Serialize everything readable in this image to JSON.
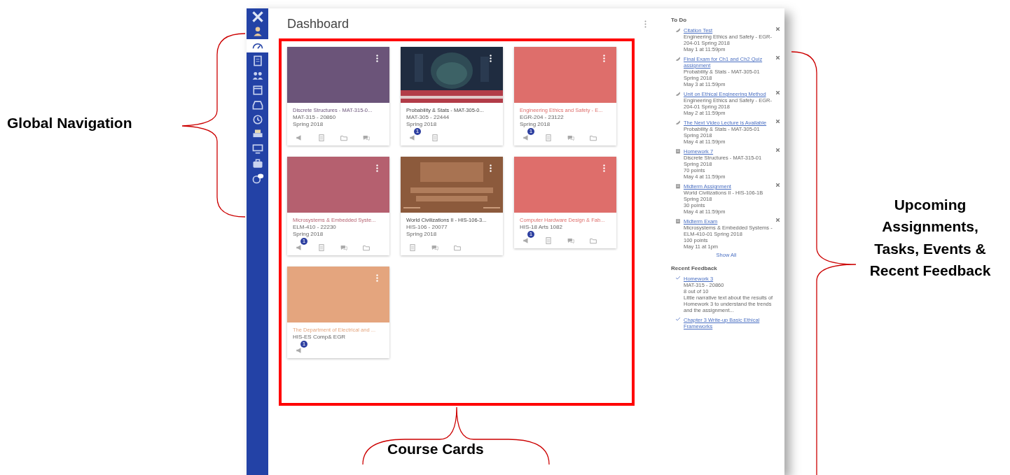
{
  "annotations": [
    {
      "kind": "left",
      "label": "Global Navigation"
    },
    {
      "kind": "bottom",
      "label": "Course Cards"
    },
    {
      "kind": "right",
      "label": "Upcoming Assignments, Tasks, Events & Recent Feedback"
    }
  ],
  "nav": [
    {
      "kind": "logo",
      "selected": false
    },
    {
      "kind": "account",
      "selected": false
    },
    {
      "kind": "dashboard",
      "selected": true
    },
    {
      "kind": "courses",
      "selected": false
    },
    {
      "kind": "groups",
      "selected": false
    },
    {
      "kind": "calendar",
      "selected": false
    },
    {
      "kind": "inbox",
      "selected": false
    },
    {
      "kind": "history",
      "selected": false
    },
    {
      "kind": "print",
      "selected": false
    },
    {
      "kind": "studio",
      "selected": false
    },
    {
      "kind": "commons",
      "selected": false
    },
    {
      "kind": "help",
      "selected": false
    }
  ],
  "page_title": "Dashboard",
  "cards": [
    {
      "kind": "color",
      "color": "#6b5479",
      "title": "Discrete Structures - MAT-315-0...",
      "code": "MAT-315 - 20860",
      "term": "Spring 2018",
      "actions": [
        {
          "kind": "announcements"
        },
        {
          "kind": "assignments"
        },
        {
          "kind": "files"
        },
        {
          "kind": "discussions"
        }
      ]
    },
    {
      "kind": "picture",
      "title": "Probability & Stats - MAT-305-0...",
      "code": "MAT-305 - 22444",
      "term": "Spring 2018",
      "actions": [
        {
          "kind": "announcements",
          "badge": "1"
        },
        {
          "kind": "assignments"
        }
      ]
    },
    {
      "kind": "color",
      "color": "#de6e6b",
      "title": "Engineering Ethics and Safety - E...",
      "code": "EGR-204 - 23122",
      "term": "Spring 2018",
      "actions": [
        {
          "kind": "announcements",
          "badge": "1"
        },
        {
          "kind": "assignments"
        },
        {
          "kind": "discussions"
        },
        {
          "kind": "files"
        }
      ]
    },
    {
      "kind": "color",
      "color": "#b5606f",
      "title": "Microsystems & Embedded Syste...",
      "code": "ELM-410 - 22230",
      "term": "Spring 2018",
      "actions": [
        {
          "kind": "announcements",
          "badge": "1"
        },
        {
          "kind": "assignments"
        },
        {
          "kind": "discussions"
        },
        {
          "kind": "files"
        }
      ]
    },
    {
      "kind": "picture",
      "title": "World Civilizations II - HIS-106-3...",
      "code": "HIS-106 - 20077",
      "term": "Spring 2018",
      "actions": [
        {
          "kind": "assignments"
        },
        {
          "kind": "discussions"
        },
        {
          "kind": "files"
        }
      ]
    },
    {
      "kind": "color",
      "color": "#de6e6b",
      "title": "Computer Hardware Design & Fab...",
      "code": "HIS-18 Arts 1082",
      "actions": [
        {
          "kind": "announcements",
          "badge": "1"
        },
        {
          "kind": "assignments"
        },
        {
          "kind": "discussions"
        },
        {
          "kind": "files"
        }
      ]
    },
    {
      "kind": "color",
      "color": "#e4a57e",
      "title": "The Department of Electrical and ...",
      "code": "HIS-ES Comp& EGR",
      "actions": [
        {
          "kind": "announcements",
          "badge": "1"
        }
      ]
    }
  ],
  "todo": {
    "title": "To Do",
    "items": [
      {
        "kind": "quiz",
        "title": "Citation Test",
        "course": "Engineering Ethics and Safety - EGR-204-01 Spring 2018",
        "due": "May 1 at 11:59pm"
      },
      {
        "kind": "quiz",
        "title": "Final Exam for Ch1 and Ch2 Quiz assignment",
        "course": "Probability & Stats - MAT-305-01 Spring 2018",
        "due": "May 3 at 11:59pm"
      },
      {
        "kind": "quiz",
        "title": "Unit on Ethical Engineering Method",
        "course": "Engineering Ethics and Safety - EGR-204-01 Spring 2018",
        "due": "May 2 at 11:59pm"
      },
      {
        "kind": "quiz",
        "title": "The Next Video Lecture is Available",
        "course": "Probability & Stats - MAT-305-01 Spring 2018",
        "due": "May 4 at 11:59pm"
      },
      {
        "kind": "assignment",
        "title": "Homework 7",
        "course": "Discrete Structures - MAT-315-01 Spring 2018",
        "points": "70 points",
        "due": "May 4 at 11:59pm"
      },
      {
        "kind": "assignment",
        "title": "Midterm Assignment",
        "course": "World Civilizations II - HIS-106-1B Spring 2018",
        "points": "30 points",
        "due": "May 4 at 11:59pm"
      },
      {
        "kind": "assignment",
        "title": "Midterm Exam",
        "course": "Microsystems & Embedded Systems - ELM-410-01 Spring 2018",
        "points": "100 points",
        "due": "May 11 at 1pm"
      }
    ],
    "show_all": "Show All"
  },
  "feedback": {
    "title": "Recent Feedback",
    "items": [
      {
        "title": "Homework 3",
        "course": "MAT-315 - 20860",
        "score": "8 out of 10",
        "comment": "Little narrative text about the results of Homework 3 to understand the trends and the assignment..."
      },
      {
        "title": "Chapter 3 Write-up Basic Ethical Frameworks"
      }
    ]
  }
}
